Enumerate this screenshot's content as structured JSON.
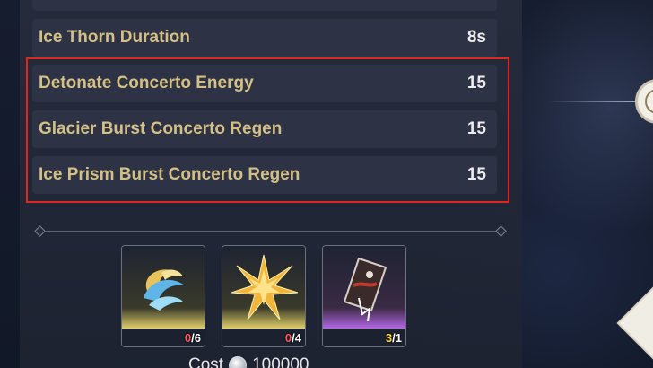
{
  "stats": [
    {
      "name": "Ice Thorn Duration",
      "value": "8s"
    },
    {
      "name": "Detonate Concerto Energy",
      "value": "15"
    },
    {
      "name": "Glacier Burst Concerto Regen",
      "value": "15"
    },
    {
      "name": "Ice Prism Burst Concerto Regen",
      "value": "15"
    }
  ],
  "materials": [
    {
      "icon": "crystal-swirl-icon",
      "have": "0",
      "need": "/6",
      "rarity_color": "#d6c25a"
    },
    {
      "icon": "gold-star-icon",
      "have": "0",
      "need": "/4",
      "rarity_color": "#d6c25a"
    },
    {
      "icon": "card-shard-icon",
      "have": "3",
      "need": "/1",
      "rarity_color": "#b468e6"
    }
  ],
  "cost": {
    "label": "Cost",
    "amount": "100000"
  },
  "colors": {
    "highlight": "#e0261f",
    "stat_name": "#d4bf86",
    "panel": "#2d3344"
  }
}
